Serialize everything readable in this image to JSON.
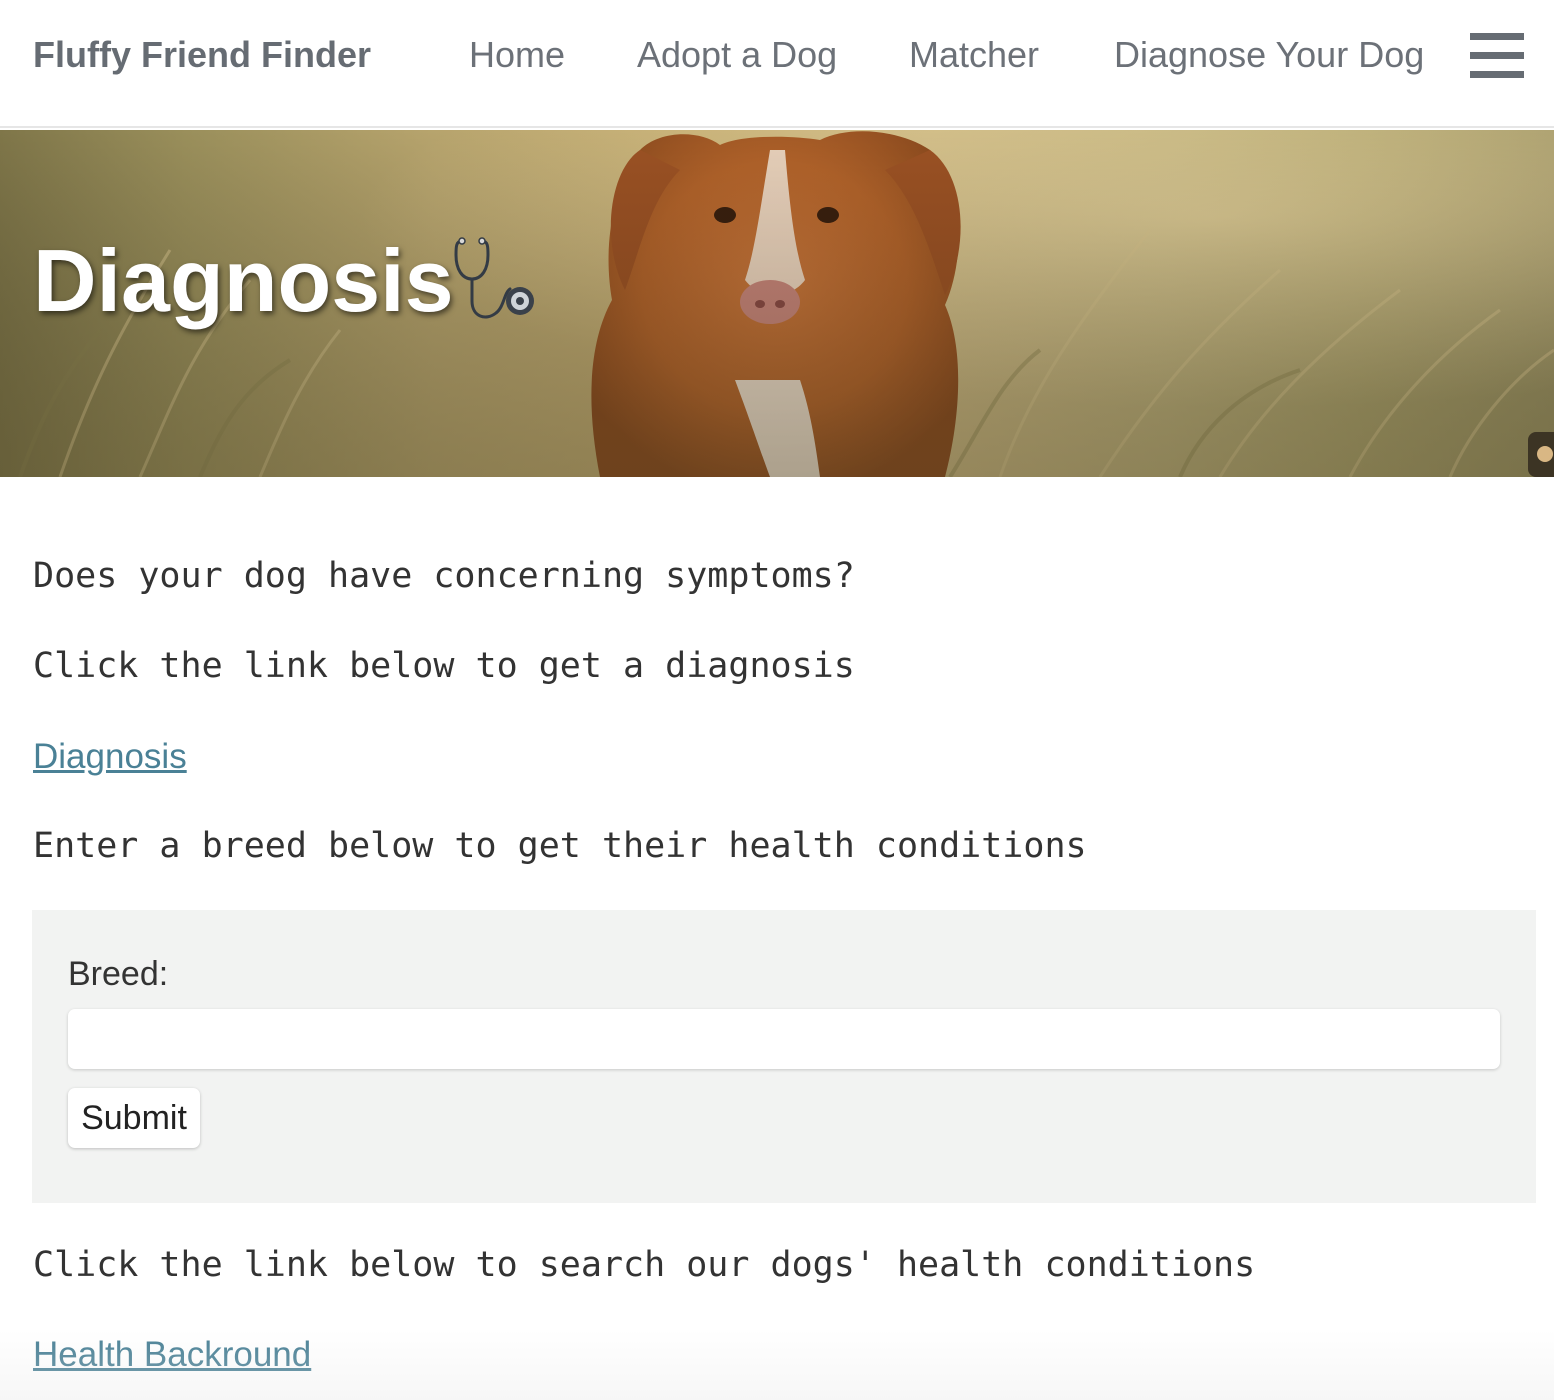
{
  "nav": {
    "brand": "Fluffy Friend Finder",
    "links": [
      "Home",
      "Adopt a Dog",
      "Matcher",
      "Diagnose Your Dog"
    ],
    "menu_icon": "hamburger-menu-icon"
  },
  "hero": {
    "title": "Diagnosis",
    "icon": "stethoscope-icon"
  },
  "content": {
    "question": "Does your dog have concerning symptoms?",
    "diagnosis_prompt": "Click the link below to get a diagnosis",
    "diagnosis_link": "Diagnosis",
    "breed_prompt": "Enter a breed below to get their health conditions",
    "health_prompt": "Click the link below to search our dogs' health conditions",
    "health_link": "Health Backround"
  },
  "form": {
    "label": "Breed:",
    "value": "",
    "placeholder": "",
    "submit_label": "Submit"
  },
  "colors": {
    "nav_text": "#6c7178",
    "link": "#4a8196",
    "form_bg": "#f2f3f2"
  }
}
